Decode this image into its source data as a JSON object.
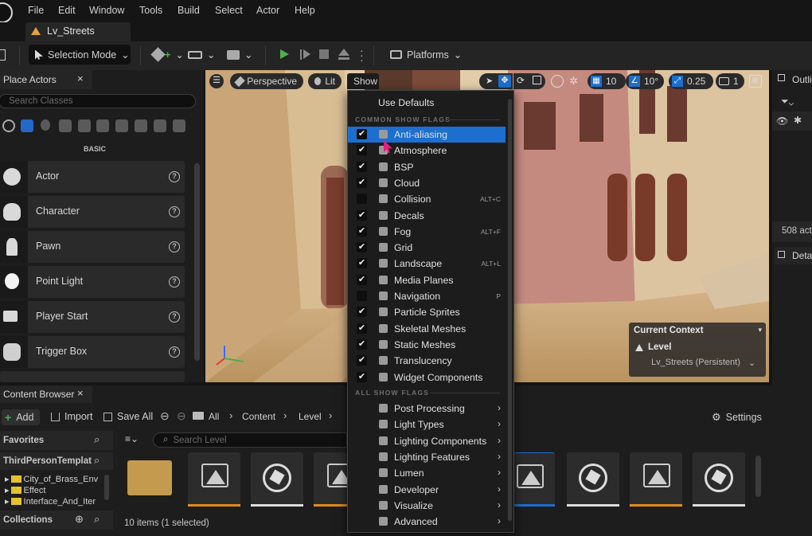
{
  "menu": [
    "File",
    "Edit",
    "Window",
    "Tools",
    "Build",
    "Select",
    "Actor",
    "Help"
  ],
  "document_tab": "Lv_Streets",
  "toolbar": {
    "selection_mode": "Selection Mode",
    "platforms": "Platforms"
  },
  "place_actors": {
    "tab": "Place Actors",
    "search_placeholder": "Search Classes",
    "section": "BASIC",
    "items": [
      "Actor",
      "Character",
      "Pawn",
      "Point Light",
      "Player Start",
      "Trigger Box"
    ]
  },
  "viewport": {
    "perspective": "Perspective",
    "lit": "Lit",
    "show": "Show",
    "grid_size": "10",
    "rotation_snap": "10°",
    "scale_snap": "0.25",
    "camera_speed": "1",
    "context": {
      "title": "Current Context",
      "level_label": "Level",
      "level_value": "Lv_Streets (Persistent)"
    }
  },
  "show_menu": {
    "use_defaults": "Use Defaults",
    "common_header": "COMMON SHOW FLAGS",
    "common": [
      {
        "label": "Anti-aliasing",
        "checked": true,
        "shortcut": "",
        "icon": "antialias-icon",
        "highlighted": true
      },
      {
        "label": "Atmosphere",
        "checked": true,
        "shortcut": "",
        "icon": "atmosphere-icon"
      },
      {
        "label": "BSP",
        "checked": true,
        "shortcut": "",
        "icon": "bsp-icon"
      },
      {
        "label": "Cloud",
        "checked": true,
        "shortcut": "",
        "icon": "cloud-icon"
      },
      {
        "label": "Collision",
        "checked": false,
        "shortcut": "ALT+C",
        "icon": "collision-icon"
      },
      {
        "label": "Decals",
        "checked": true,
        "shortcut": "",
        "icon": "decals-icon"
      },
      {
        "label": "Fog",
        "checked": true,
        "shortcut": "ALT+F",
        "icon": "fog-icon"
      },
      {
        "label": "Grid",
        "checked": true,
        "shortcut": "",
        "icon": "grid-icon"
      },
      {
        "label": "Landscape",
        "checked": true,
        "shortcut": "ALT+L",
        "icon": "landscape-icon"
      },
      {
        "label": "Media Planes",
        "checked": true,
        "shortcut": "",
        "icon": "media-planes-icon"
      },
      {
        "label": "Navigation",
        "checked": false,
        "shortcut": "P",
        "icon": "navigation-icon"
      },
      {
        "label": "Particle Sprites",
        "checked": true,
        "shortcut": "",
        "icon": "particle-sprites-icon"
      },
      {
        "label": "Skeletal Meshes",
        "checked": true,
        "shortcut": "",
        "icon": "skeletal-meshes-icon"
      },
      {
        "label": "Static Meshes",
        "checked": true,
        "shortcut": "",
        "icon": "static-meshes-icon"
      },
      {
        "label": "Translucency",
        "checked": true,
        "shortcut": "",
        "icon": "translucency-icon"
      },
      {
        "label": "Widget Components",
        "checked": true,
        "shortcut": "",
        "icon": "widget-components-icon"
      }
    ],
    "all_header": "ALL SHOW FLAGS",
    "all": [
      "Post Processing",
      "Light Types",
      "Lighting Components",
      "Lighting Features",
      "Lumen",
      "Developer",
      "Visualize",
      "Advanced"
    ]
  },
  "content_browser": {
    "tab": "Content Browser",
    "add": "Add",
    "import": "Import",
    "save_all": "Save All",
    "path": [
      "All",
      "Content",
      "Level"
    ],
    "settings": "Settings",
    "favorites": "Favorites",
    "project": "ThirdPersonTemplat",
    "tree": [
      "City_of_Brass_Env",
      "Effect",
      "Interface_And_Iter"
    ],
    "collections": "Collections",
    "search_placeholder": "Search Level",
    "status": "10 items (1 selected)"
  },
  "outliner": {
    "tab": "Outli",
    "actor_count": "508 act",
    "details": "Deta"
  },
  "colors": {
    "accent": "#1c6fcf",
    "play": "#4caf50",
    "level_icon": "#e3a23b",
    "folder": "#e3c12f"
  }
}
